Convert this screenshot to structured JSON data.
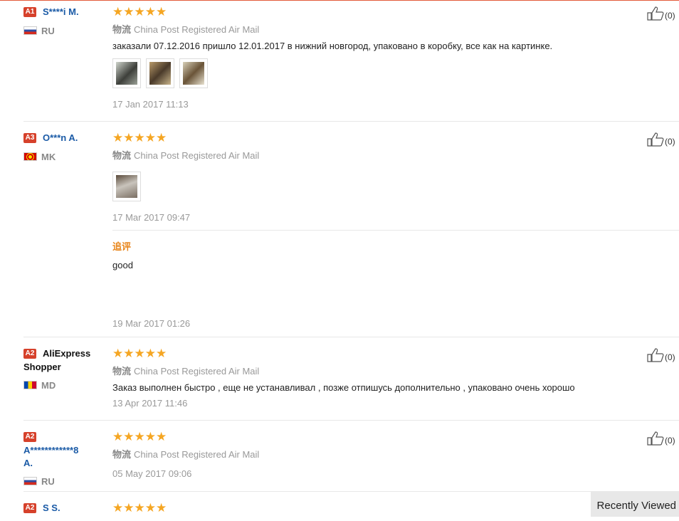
{
  "reviews": [
    {
      "badge": "A1",
      "name": "S****i M.",
      "country": "RU",
      "stars": "★★★★★",
      "ship_label": "物流",
      "ship_method": "China Post Registered Air Mail",
      "text": "заказали 07.12.2016 пришло 12.01.2017 в нижний новгород, упаковано в коробку, все как на картинке.",
      "date": "17 Jan 2017 11:13",
      "likes": "(0)"
    },
    {
      "badge": "A3",
      "name": "O***n A.",
      "country": "MK",
      "stars": "★★★★★",
      "ship_label": "物流",
      "ship_method": "China Post Registered Air Mail",
      "date": "17 Mar 2017 09:47",
      "likes": "(0)",
      "additional": {
        "label": "追评",
        "text": "good",
        "date": "19 Mar 2017 01:26"
      }
    },
    {
      "badge": "A2",
      "name_line1": "AliExpress",
      "name_line2": "Shopper",
      "country": "MD",
      "stars": "★★★★★",
      "ship_label": "物流",
      "ship_method": "China Post Registered Air Mail",
      "text": "Заказ выполнен быстро , еще не устанавливал , позже отпишусь дополнительно , упаковано очень хорошо",
      "date": "13 Apr 2017 11:46",
      "likes": "(0)"
    },
    {
      "badge": "A2",
      "name_line1": "A************8",
      "name_line2": "A.",
      "country": "RU",
      "stars": "★★★★★",
      "ship_label": "物流",
      "ship_method": "China Post Registered Air Mail",
      "date": "05 May 2017 09:06",
      "likes": "(0)"
    },
    {
      "badge": "A2",
      "name": "S S.",
      "stars": "★★★★★"
    }
  ],
  "recently_viewed": "Recently Viewed",
  "icons": {
    "like": "thumbs-up-icon"
  }
}
